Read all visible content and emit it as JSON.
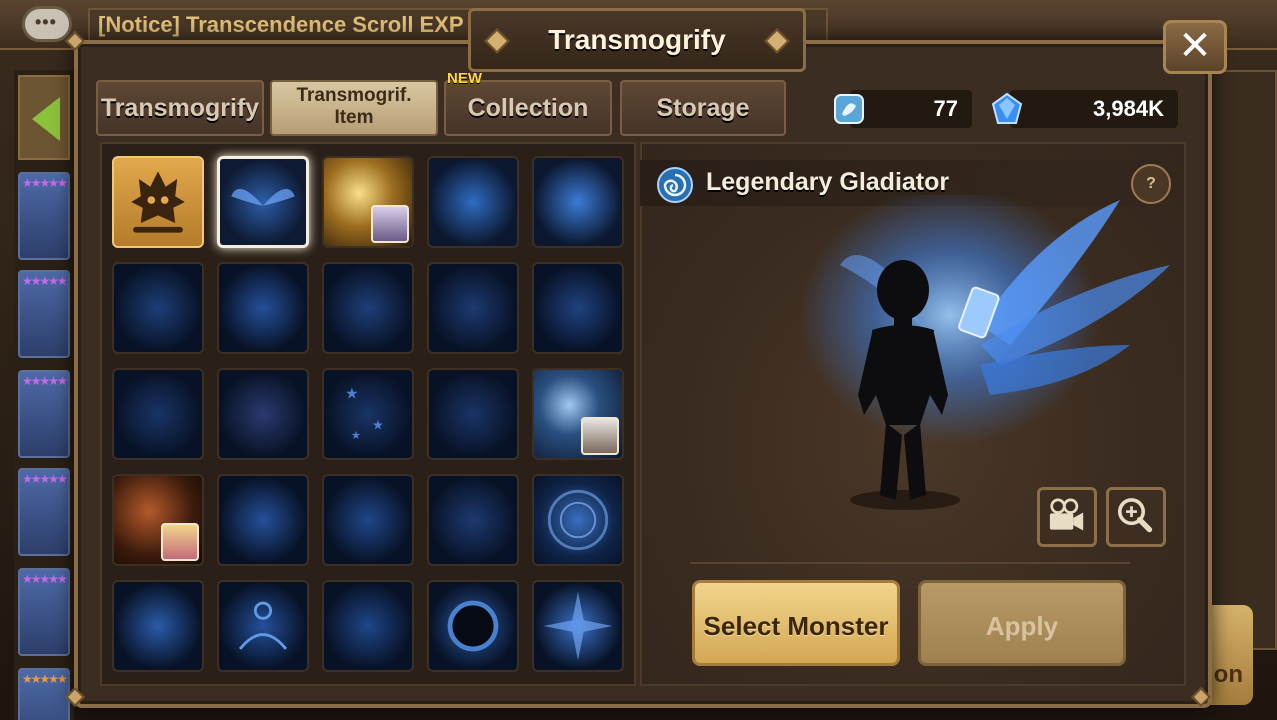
{
  "background": {
    "notice_text": "[Notice] Transcendence Scroll EXP",
    "right_button_fragment": "on"
  },
  "dialog": {
    "title": "Transmogrify",
    "close_label": "✕"
  },
  "tabs": [
    {
      "label": "Transmogrify",
      "active": false
    },
    {
      "label": "Transmogrif.",
      "label2": "Item",
      "active": true
    },
    {
      "label": "Collection",
      "active": false,
      "badge": "NEW"
    },
    {
      "label": "Storage",
      "active": false
    }
  ],
  "currency": {
    "scrolls": "77",
    "crystals": "3,984K"
  },
  "preview": {
    "name": "Legendary Gladiator",
    "help_label": "?"
  },
  "buttons": {
    "select_monster": "Select Monster",
    "apply": "Apply"
  },
  "colors": {
    "accent_gold": "#d3a753",
    "effect_blue": "#3f8cff",
    "frame_brown": "#8c6d45"
  }
}
